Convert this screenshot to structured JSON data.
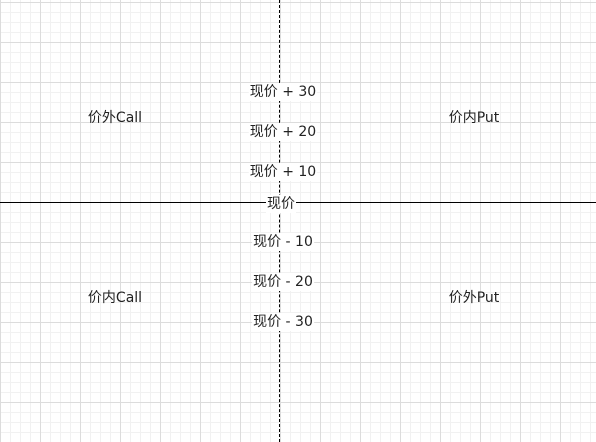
{
  "axes": {
    "center_label": "现价"
  },
  "quadrants": {
    "top_left": "价外Call",
    "top_right": "价内Put",
    "bottom_left": "价内Call",
    "bottom_right": "价外Put"
  },
  "price_levels": {
    "plus_30": "现价 + 30",
    "plus_20": "现价 + 20",
    "plus_10": "现价 + 10",
    "minus_10": "现价 - 10",
    "minus_20": "现价 - 20",
    "minus_30": "现价 - 30"
  }
}
